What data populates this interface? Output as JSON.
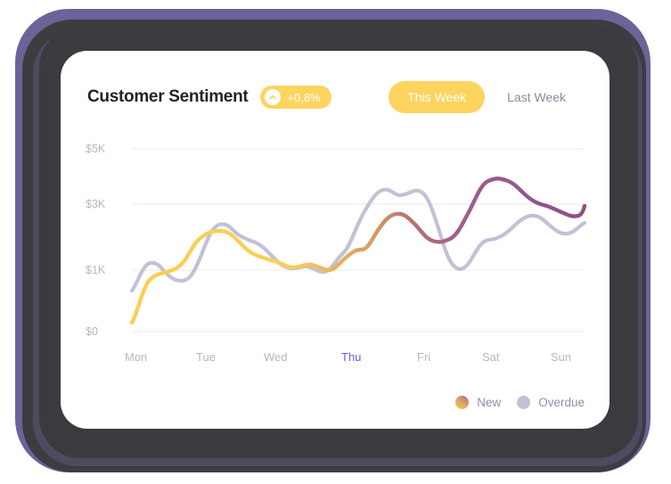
{
  "card": {
    "title": "Customer Sentiment",
    "delta": {
      "value": "+0,8%",
      "icon": "chevron-up-circle-icon",
      "color": "#fcd45f"
    },
    "tabs": [
      {
        "label": "This Week",
        "active": true
      },
      {
        "label": "Last Week",
        "active": false
      }
    ]
  },
  "legend": [
    {
      "label": "New",
      "color": "#fbcf55"
    },
    {
      "label": "Overdue",
      "color": "#c3c1d4"
    }
  ],
  "chart_data": {
    "type": "line",
    "title": "Customer Sentiment",
    "xlabel": "",
    "ylabel": "",
    "ylim": [
      0,
      5600
    ],
    "ytick_values": [
      0,
      1000,
      3000,
      5000
    ],
    "ytick_labels": [
      "$0",
      "$1K",
      "$3K",
      "$5K"
    ],
    "categories": [
      "Mon",
      "Tue",
      "Wed",
      "Thu",
      "Fri",
      "Sat",
      "Sun"
    ],
    "highlighted_category": "Thu",
    "grid": true,
    "legend_position": "bottom-right",
    "series": [
      {
        "name": "New",
        "color": "#fbcf55",
        "gradient": [
          "#fbcf55",
          "#d9a062",
          "#9d5f8f",
          "#8f4f83"
        ],
        "x": [
          0,
          0.25,
          0.5,
          0.75,
          1,
          1.25,
          1.5,
          1.75,
          2,
          2.25,
          2.5,
          2.75,
          3,
          3.25,
          3.5,
          3.75,
          4,
          4.25,
          4.5,
          4.75,
          5,
          5.25,
          5.5,
          5.75,
          6
        ],
        "values": [
          150,
          880,
          1000,
          1120,
          1640,
          1720,
          1540,
          1350,
          1280,
          1200,
          1100,
          1140,
          1280,
          1290,
          1700,
          2320,
          2480,
          2200,
          1950,
          1970,
          2620,
          3420,
          3480,
          3200,
          2980
        ]
      },
      {
        "name": "Overdue",
        "color": "#c3c1d4",
        "x": [
          0,
          0.25,
          0.5,
          0.75,
          1,
          1.25,
          1.5,
          1.75,
          2,
          2.25,
          2.5,
          2.75,
          3,
          3.25,
          3.5,
          3.75,
          4,
          4.25,
          4.5,
          4.75,
          5,
          5.25,
          5.5,
          5.75,
          6
        ],
        "values": [
          680,
          1130,
          1060,
          930,
          1020,
          1700,
          1790,
          1640,
          1590,
          1390,
          1180,
          1140,
          1230,
          1120,
          1500,
          2600,
          3160,
          3140,
          2280,
          1360,
          1490,
          1700,
          2480,
          2720,
          2620
        ]
      }
    ]
  }
}
